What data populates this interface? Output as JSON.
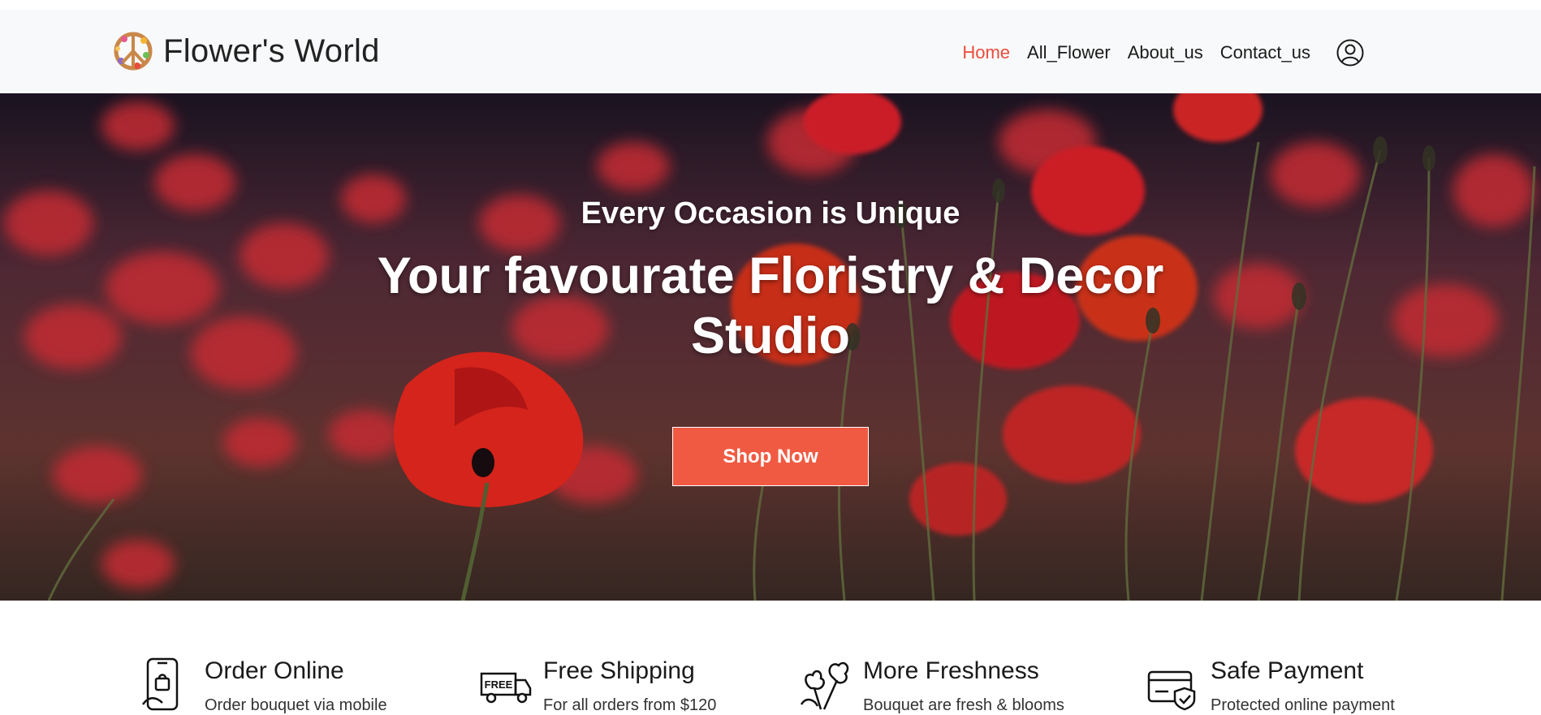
{
  "brand": {
    "name": "Flower's World",
    "logo_icon": "peace-flower-logo"
  },
  "nav": {
    "items": [
      {
        "label": "Home",
        "active": true
      },
      {
        "label": "All_Flower",
        "active": false
      },
      {
        "label": "About_us",
        "active": false
      },
      {
        "label": "Contact_us",
        "active": false
      }
    ],
    "user_icon": "user-circle-icon"
  },
  "hero": {
    "subtitle": "Every Occasion is Unique",
    "title": "Your favourate Floristry & Decor Studio",
    "button_label": "Shop Now",
    "background": "red poppy field photo"
  },
  "features": [
    {
      "icon": "mobile-shopping-icon",
      "title": "Order Online",
      "desc": "Order bouquet via mobile"
    },
    {
      "icon": "free-shipping-truck-icon",
      "title": "Free Shipping",
      "desc": "For all orders from $120"
    },
    {
      "icon": "flowers-icon",
      "title": "More Freshness",
      "desc": "Bouquet are fresh & blooms"
    },
    {
      "icon": "secure-card-icon",
      "title": "Safe Payment",
      "desc": "Protected online payment"
    }
  ],
  "colors": {
    "accent": "#ea4c3c",
    "button": "#f05a42",
    "navbar_bg": "#f8f9fa"
  }
}
